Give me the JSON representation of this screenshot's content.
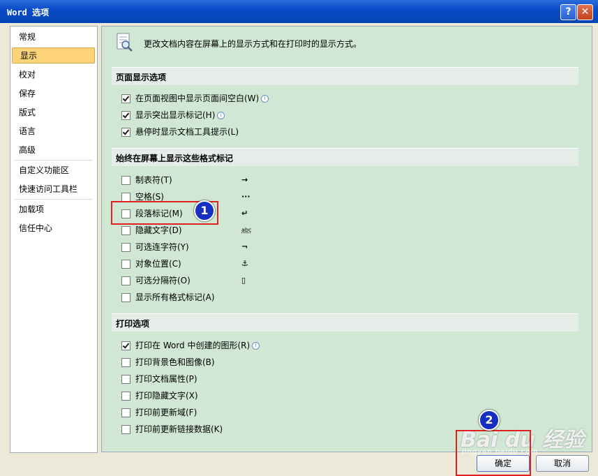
{
  "window": {
    "title": "Word 选项",
    "help_label": "?",
    "close_label": "✕"
  },
  "sidebar": {
    "items": [
      {
        "label": "常规"
      },
      {
        "label": "显示"
      },
      {
        "label": "校对"
      },
      {
        "label": "保存"
      },
      {
        "label": "版式"
      },
      {
        "label": "语言"
      },
      {
        "label": "高级"
      },
      {
        "label": "自定义功能区"
      },
      {
        "label": "快速访问工具栏"
      },
      {
        "label": "加载项"
      },
      {
        "label": "信任中心"
      }
    ],
    "selected": "显示"
  },
  "main": {
    "header": "更改文档内容在屏幕上的显示方式和在打印时的显示方式。",
    "sections": {
      "page_display": "页面显示选项",
      "formatting_marks": "始终在屏幕上显示这些格式标记",
      "print": "打印选项"
    },
    "page_display_options": [
      {
        "label": "在页面视图中显示页面间空白(W)",
        "checked": true,
        "info": true
      },
      {
        "label": "显示突出显示标记(H)",
        "checked": true,
        "info": true
      },
      {
        "label": "悬停时显示文档工具提示(L)",
        "checked": true,
        "info": false
      }
    ],
    "format_marks": [
      {
        "label": "制表符(T)",
        "checked": false,
        "symbol": "→"
      },
      {
        "label": "空格(S)",
        "checked": false,
        "symbol": "···"
      },
      {
        "label": "段落标记(M)",
        "checked": false,
        "symbol": "↵"
      },
      {
        "label": "隐藏文字(D)",
        "checked": false,
        "symbol": "abc"
      },
      {
        "label": "可选连字符(Y)",
        "checked": false,
        "symbol": "¬"
      },
      {
        "label": "对象位置(C)",
        "checked": false,
        "symbol": "⚓"
      },
      {
        "label": "可选分隔符(O)",
        "checked": false,
        "symbol": "▯"
      },
      {
        "label": "显示所有格式标记(A)",
        "checked": false,
        "symbol": ""
      }
    ],
    "print_options": [
      {
        "label": "打印在 Word 中创建的图形(R)",
        "checked": true,
        "info": true
      },
      {
        "label": "打印背景色和图像(B)",
        "checked": false,
        "info": false
      },
      {
        "label": "打印文档属性(P)",
        "checked": false,
        "info": false
      },
      {
        "label": "打印隐藏文字(X)",
        "checked": false,
        "info": false
      },
      {
        "label": "打印前更新域(F)",
        "checked": false,
        "info": false
      },
      {
        "label": "打印前更新链接数据(K)",
        "checked": false,
        "info": false
      }
    ]
  },
  "footer": {
    "ok_label": "确定",
    "cancel_label": "取消"
  },
  "annotations": {
    "step1": "1",
    "step2": "2"
  },
  "watermark": {
    "text": "Bai du 经验",
    "sub": "jingyan.baidu.com"
  }
}
